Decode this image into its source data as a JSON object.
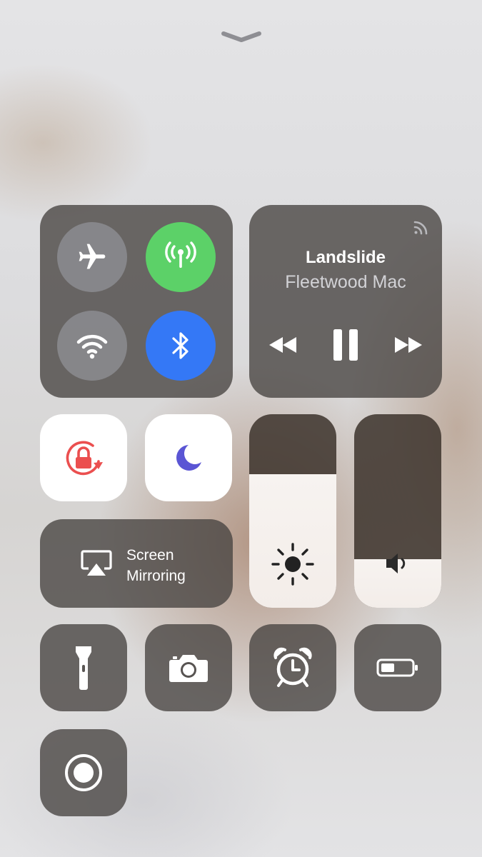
{
  "now_playing": {
    "title": "Landslide",
    "artist": "Fleetwood Mac"
  },
  "screen_mirroring": {
    "line1": "Screen",
    "line2": "Mirroring"
  },
  "brightness": {
    "level": 0.69
  },
  "volume": {
    "level": 0.25
  },
  "connectivity": {
    "airplane_mode": false,
    "cellular": true,
    "wifi": false,
    "bluetooth": true
  },
  "colors": {
    "cellular_on": "#5cd168",
    "bluetooth_on": "#3478f6",
    "rotation_lock": "#eb4f4f",
    "do_not_disturb": "#5a55d4"
  },
  "icons": [
    "chevron-down-icon",
    "airplane-icon",
    "antenna-icon",
    "wifi-icon",
    "bluetooth-icon",
    "airplay-audio-icon",
    "rewind-icon",
    "pause-icon",
    "fast-forward-icon",
    "rotation-lock-icon",
    "moon-icon",
    "screen-mirroring-icon",
    "sun-icon",
    "speaker-icon",
    "flashlight-icon",
    "camera-icon",
    "alarm-clock-icon",
    "battery-icon",
    "record-icon"
  ]
}
